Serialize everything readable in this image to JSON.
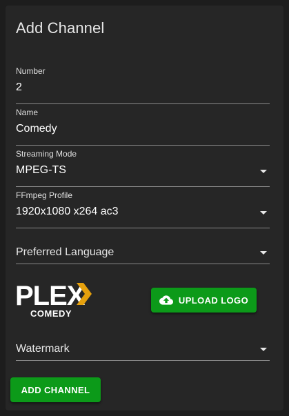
{
  "dialog": {
    "title": "Add Channel"
  },
  "fields": {
    "number": {
      "label": "Number",
      "value": "2"
    },
    "name": {
      "label": "Name",
      "value": "Comedy"
    },
    "streaming_mode": {
      "label": "Streaming Mode",
      "value": "MPEG-TS"
    },
    "ffmpeg_profile": {
      "label": "FFmpeg Profile",
      "value": "1920x1080 x264 ac3"
    },
    "preferred_language": {
      "placeholder": "Preferred Language"
    },
    "watermark": {
      "placeholder": "Watermark"
    }
  },
  "logo": {
    "wordmark": "PLEX",
    "subtitle": "COMEDY",
    "accent_color": "#e5a00d"
  },
  "buttons": {
    "upload_logo": "UPLOAD LOGO",
    "upload_icon": "cloud-upload-icon",
    "add_channel": "ADD CHANNEL"
  },
  "colors": {
    "primary_button": "#0c9a19",
    "panel": "#262626",
    "background": "#1d1d1d"
  }
}
